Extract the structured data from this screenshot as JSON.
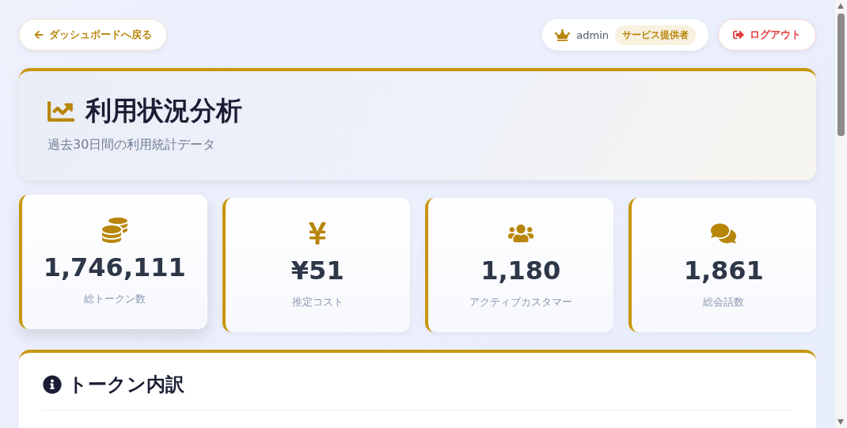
{
  "header": {
    "back_button": "ダッシュボードへ戻る",
    "user": {
      "name": "admin",
      "role": "サービス提供者"
    },
    "logout_button": "ログアウト"
  },
  "hero": {
    "title": "利用状況分析",
    "subtitle": "過去30日間の利用統計データ"
  },
  "stats": [
    {
      "kind": "tokens",
      "value": "1,746,111",
      "label": "総トークン数",
      "hovered": true
    },
    {
      "kind": "cost",
      "value": "¥51",
      "label": "推定コスト",
      "hovered": false
    },
    {
      "kind": "customers",
      "value": "1,180",
      "label": "アクティブカスタマー",
      "hovered": false
    },
    {
      "kind": "conversations",
      "value": "1,861",
      "label": "総会話数",
      "hovered": false
    }
  ],
  "section": {
    "title": "トークン内訳"
  }
}
